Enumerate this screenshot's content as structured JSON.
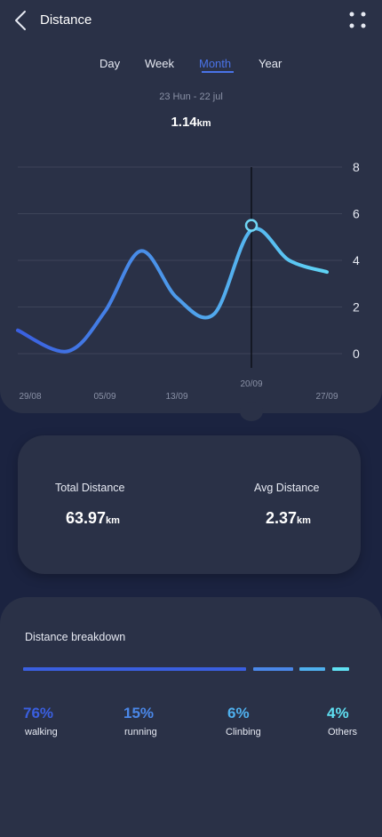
{
  "header": {
    "title": "Distance"
  },
  "tabs": [
    {
      "label": "Day",
      "active": false
    },
    {
      "label": "Week",
      "active": false
    },
    {
      "label": "Month",
      "active": true
    },
    {
      "label": "Year",
      "active": false
    }
  ],
  "summary": {
    "date_range": "23 Hun - 22 jul",
    "value": "1.14",
    "unit": "km"
  },
  "chart_data": {
    "type": "line",
    "x_tick_labels": [
      "29/08",
      "05/09",
      "13/09",
      "20/09",
      "27/09"
    ],
    "y_tick_labels": [
      "8",
      "6",
      "4",
      "2",
      "0"
    ],
    "ylim": [
      0,
      8
    ],
    "grid": true,
    "series": [
      {
        "x": [
          0.0,
          0.5,
          1.0,
          1.5,
          2.0,
          2.5,
          3.0,
          3.5,
          4.0
        ],
        "values": [
          1.0,
          0.1,
          1.8,
          4.4,
          2.4,
          1.7,
          5.3,
          4.0,
          3.5
        ]
      }
    ],
    "selected": {
      "x_label": "20/09",
      "x": 3.0,
      "value": 5.5
    },
    "colors": {
      "line_start": "#3a5fe0",
      "line_end": "#5fd4f5",
      "grid": "#3d4459"
    }
  },
  "stats": {
    "total": {
      "label": "Total Distance",
      "value": "63.97",
      "unit": "km"
    },
    "avg": {
      "label": "Avg Distance",
      "value": "2.37",
      "unit": "km"
    }
  },
  "breakdown": {
    "title": "Distance breakdown",
    "items": [
      {
        "percent": "76%",
        "fraction": 0.76,
        "label": "walking",
        "color": "#3a5fe0"
      },
      {
        "percent": "15%",
        "fraction": 0.15,
        "label": "running",
        "color": "#4a87e8"
      },
      {
        "percent": "6%",
        "fraction": 0.06,
        "label": "Clinbing",
        "color": "#4fb0ee"
      },
      {
        "percent": "4%",
        "fraction": 0.04,
        "label": "Others",
        "color": "#5fe0f2"
      }
    ]
  }
}
